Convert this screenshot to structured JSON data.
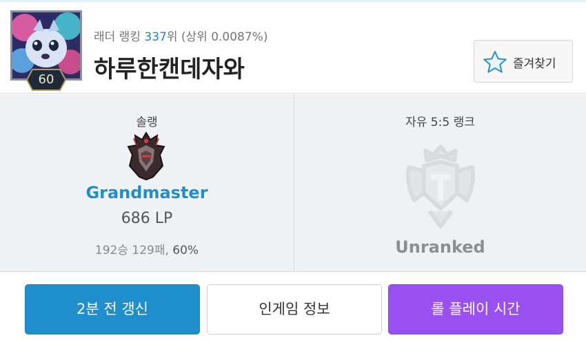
{
  "profile": {
    "level": "60",
    "ladder_label": "래더 랭킹",
    "ladder_rank": "337",
    "ladder_suffix": "위 (상위 0.0087%)",
    "summoner_name": "하루한캔데자와",
    "favorite_label": "즐겨찾기",
    "favorite_icon": "star-outline-icon"
  },
  "ranks": {
    "solo": {
      "queue": "솔랭",
      "tier": "Grandmaster",
      "lp": "686 LP",
      "record": "192승 129패, ",
      "winrate": "60%",
      "emblem_icon": "grandmaster-emblem-icon"
    },
    "flex": {
      "queue": "자유 5:5 랭크",
      "tier": "Unranked",
      "emblem_icon": "unranked-emblem-icon"
    }
  },
  "actions": {
    "refresh": "2분 전 갱신",
    "ingame": "인게임 정보",
    "playtime": "롤 플레이 시간"
  },
  "colors": {
    "accent_blue": "#1f8ecd",
    "accent_purple": "#9a4ff0",
    "panel_bg": "#eff2f4"
  }
}
